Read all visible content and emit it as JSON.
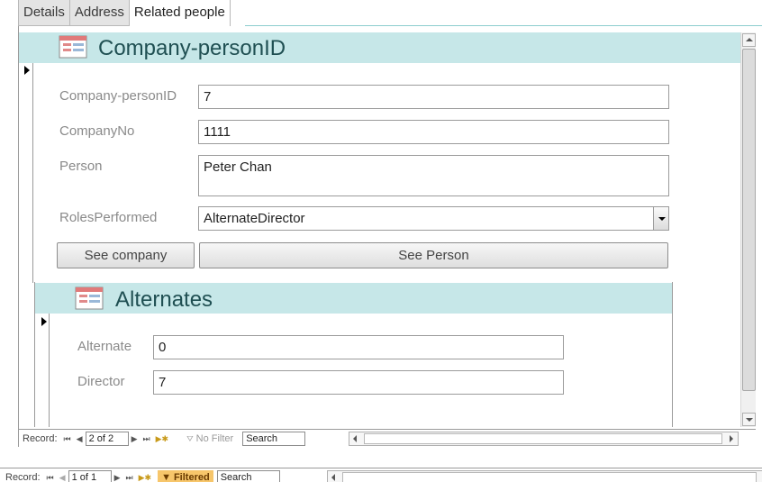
{
  "tabs": [
    {
      "label": "Details"
    },
    {
      "label": "Address"
    },
    {
      "label": "Related people"
    }
  ],
  "main_form": {
    "title": "Company-personID",
    "fields": {
      "company_person_id": {
        "label": "Company-personID",
        "value": "7"
      },
      "company_no": {
        "label": "CompanyNo",
        "value": "1111"
      },
      "person": {
        "label": "Person",
        "value": "Peter Chan"
      },
      "roles_performed": {
        "label": "RolesPerformed",
        "value": "AlternateDirector"
      }
    },
    "buttons": {
      "see_company": "See company",
      "see_person": "See Person"
    }
  },
  "subform": {
    "title": "Alternates",
    "fields": {
      "alternate": {
        "label": "Alternate",
        "value": "0"
      },
      "director": {
        "label": "Director",
        "value": "7"
      }
    }
  },
  "inner_nav": {
    "label": "Record:",
    "position": "2 of 2",
    "filter": "No Filter",
    "search": "Search"
  },
  "outer_nav": {
    "label": "Record:",
    "position": "1 of 1",
    "filter": "Filtered",
    "search": "Search"
  },
  "colors": {
    "header_band": "#c6e7e8",
    "header_text": "#1f4f52",
    "filtered_badge": "#f7c66b"
  }
}
